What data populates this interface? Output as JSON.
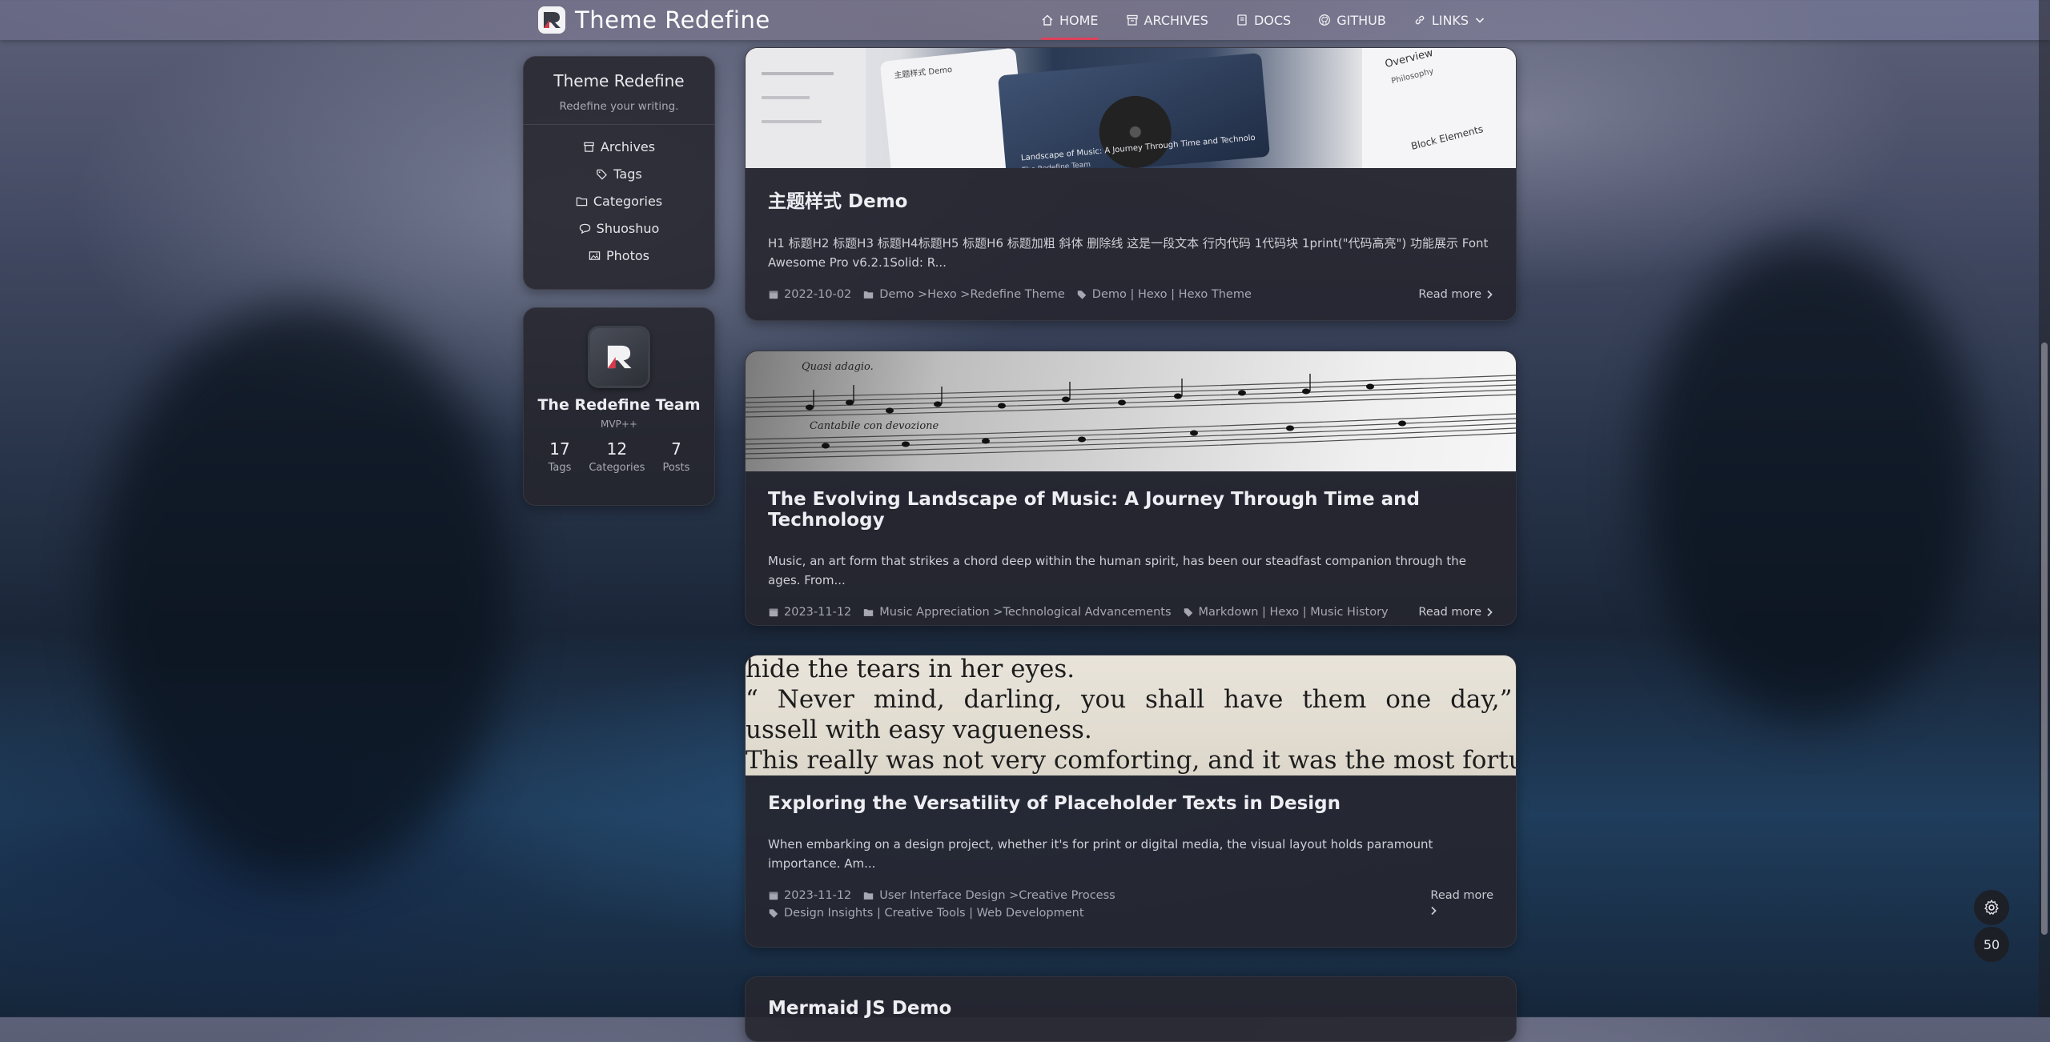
{
  "header": {
    "brand": "Theme Redefine",
    "nav": [
      {
        "label": "HOME",
        "icon": "home-icon",
        "active": true
      },
      {
        "label": "ARCHIVES",
        "icon": "archive-icon",
        "active": false
      },
      {
        "label": "DOCS",
        "icon": "book-icon",
        "active": false
      },
      {
        "label": "GITHUB",
        "icon": "github-icon",
        "active": false
      },
      {
        "label": "LINKS",
        "icon": "link-icon",
        "active": false
      }
    ]
  },
  "sidebar": {
    "site_title": "Theme Redefine",
    "site_subtitle": "Redefine your writing.",
    "menu": [
      {
        "label": "Archives",
        "icon": "archive-icon"
      },
      {
        "label": "Tags",
        "icon": "tag-icon"
      },
      {
        "label": "Categories",
        "icon": "folder-icon"
      },
      {
        "label": "Shuoshuo",
        "icon": "comment-icon"
      },
      {
        "label": "Photos",
        "icon": "image-icon"
      }
    ],
    "author": {
      "name": "The Redefine Team",
      "role": "MVP++",
      "stats": [
        {
          "number": "17",
          "label": "Tags"
        },
        {
          "number": "12",
          "label": "Categories"
        },
        {
          "number": "7",
          "label": "Posts"
        }
      ]
    }
  },
  "posts": [
    {
      "title": "主题样式 Demo",
      "excerpt": "H1 标题H2 标题H3 标题H4标题H5 标题H6 标题加粗 斜体 删除线 这是一段文本 行内代码 1代码块 1print(\"代码高亮\") 功能展示 Font Awesome Pro v6.2.1Solid: R...",
      "date": "2022-10-02",
      "category": "Demo >Hexo >Redefine Theme",
      "tags": "Demo | Hexo | Hexo Theme",
      "read_more": "Read more"
    },
    {
      "title": "The Evolving Landscape of Music: A Journey Through Time and Technology",
      "excerpt": "Music, an art form that strikes a chord deep within the human spirit, has been our steadfast companion through the ages. From...",
      "date": "2023-11-12",
      "category": "Music Appreciation >Technological Advancements",
      "tags": "Markdown | Hexo | Music History",
      "read_more": "Read more",
      "cover_text": [
        "Quasi adagio.",
        "Cantabile con devozione"
      ]
    },
    {
      "title": "Exploring the Versatility of Placeholder Texts in Design",
      "excerpt": "When embarking on a design project, whether it's for print or digital media, the visual layout holds paramount importance. Am...",
      "date": "2023-11-12",
      "category": "User Interface Design >Creative Process",
      "tags": "Design Insights | Creative Tools | Web Development",
      "read_more": "Read more",
      "cover_text": [
        "hide the tears in her eyes.",
        "“ Never mind, darling, you shall have them one day,” answered",
        "ussell with easy vagueness.",
        "This really was not very comforting, and it was the most fortunate thing"
      ]
    },
    {
      "title": "Mermaid JS Demo"
    }
  ],
  "post1_cover_text": {
    "left_title": "主题样式 Demo",
    "overview": "Overview",
    "philosophy": "Philosophy",
    "block_elements": "Block Elements",
    "card_caption": "Landscape of Music: A Journey Through Time and Technolo",
    "card_foot": "The Redefine Team"
  },
  "tools": {
    "settings_icon": "gear-icon",
    "scroll_percent": "50"
  }
}
